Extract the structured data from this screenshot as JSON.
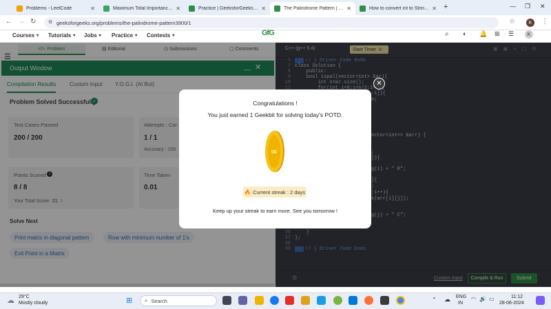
{
  "browser": {
    "tabs": [
      {
        "label": "Problems - LeetCode",
        "color": "#f2a100"
      },
      {
        "label": "Maximum Total Importance of",
        "color": "#3aa365"
      },
      {
        "label": "Practice | GeeksforGeeks | A co",
        "color": "#2f8d46"
      },
      {
        "label": "The Palindrome Pattern | Practi",
        "color": "#2f8d46"
      },
      {
        "label": "How to convert int to String in",
        "color": "#2f8d46"
      }
    ],
    "new_tab": "+",
    "url": "geeksforgeeks.org/problems/the-palindrome-pattern3900/1",
    "profile_letter": "K"
  },
  "site": {
    "nav": [
      "Courses",
      "Tutorials",
      "Jobs",
      "Practice",
      "Contests"
    ],
    "logo": "GfG"
  },
  "problem_tabs": [
    "Problem",
    "Editorial",
    "Submissions",
    "Comments"
  ],
  "output_window": {
    "title": "Output Window",
    "subtabs": [
      "Compilation Results",
      "Custom Input",
      "Y.O.G.I. (AI Bot)"
    ],
    "status": "Problem Solved Successfully",
    "test_cases_label": "Test Cases Passed",
    "test_cases_value": "200 / 200",
    "attempts_label": "Attempts : Cor",
    "attempts_value": "1 / 1",
    "accuracy_label": "Accuracy : 100",
    "points_label": "Points Scored",
    "points_value": "8 / 8",
    "total_score_label": "Your Total Score:",
    "total_score_value": "21",
    "time_label": "Time Taken",
    "time_value": "0.01",
    "solve_next_title": "Solve Next",
    "solve_next": [
      "Print matrix in diagonal pattern",
      "Row with minimum number of 1's",
      "Exit Point in a Matrix"
    ]
  },
  "editor": {
    "language": "C++ (g++ 5.4)",
    "timer_label": "Start Timer",
    "lines": [
      {
        "n": "1",
        "code": "// } Driver Code Ends"
      },
      {
        "n": "7",
        "code": "class Solution {"
      },
      {
        "n": "8",
        "code": "    public:"
      },
      {
        "n": "9",
        "code": "    bool ispal(vector<int> &ar){"
      },
      {
        "n": "10",
        "code": "        int n=ar.size();"
      },
      {
        "n": "11",
        "code": "        for(int i=0;i<n/2;i++){"
      }
    ],
    "frag": [
      {
        "text": "-i]){"
      },
      {
        "text": "e;"
      },
      {
        "text": "ector<int>> &arr) {"
      },
      {
        "text": ";"
      },
      {
        "text": "]){"
      },
      {
        "text": "g(i) + \" R\";"
      },
      {
        "text": "]{"
      },
      {
        "text": ";"
      },
      {
        "text": ";i++){"
      },
      {
        "text": "k(arr[i][j]);"
      },
      {
        "text": "g(j) + \" C\";"
      }
    ],
    "tail": [
      {
        "n": "36",
        "code": "    }"
      },
      {
        "n": "37",
        "code": "};"
      },
      {
        "n": "38",
        "code": ""
      },
      {
        "n": "39",
        "code": "// } Driver Code Ends"
      }
    ],
    "custom_input": "Custom Input",
    "compile_run": "Compile & Run",
    "submit": "Submit"
  },
  "modal": {
    "title": "Congratulations !",
    "message": "You just earned 1 Geekbit for solving today's POTD.",
    "streak": "Current streak : 2 days",
    "footer": "Keep up your streak to earn more. See you tomorrow !"
  },
  "taskbar": {
    "weather_temp": "29°C",
    "weather_desc": "Mostly cloudy",
    "search_placeholder": "Search",
    "lang_top": "ENG",
    "lang_bottom": "IN",
    "time": "11:12",
    "date": "28-06-2024"
  },
  "colors": {
    "gfg_green": "#2f8d46",
    "dark_editor": "#3a3d45",
    "accent_green": "#1f8a58"
  }
}
